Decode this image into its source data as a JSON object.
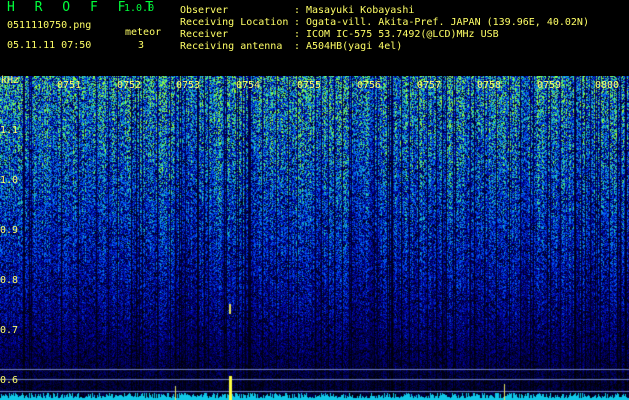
{
  "app": {
    "name": "H R O F F T",
    "version": "1.0.0"
  },
  "file": {
    "name": "0511110750.png",
    "datetime": "05.11.11 07:50"
  },
  "meteor": {
    "label": "meteor",
    "count": "3"
  },
  "info": [
    {
      "label": "Observer",
      "sep": ":",
      "value": "Masayuki Kobayashi"
    },
    {
      "label": "Receiving Location",
      "sep": ":",
      "value": "Ogata-vill. Akita-Pref. JAPAN (139.96E, 40.02N)"
    },
    {
      "label": "Receiver",
      "sep": ":",
      "value": "ICOM IC-575 53.7492(@LCD)MHz USB"
    },
    {
      "label": "Receiving antenna",
      "sep": ":",
      "value": "A504HB(yagi 4el)"
    }
  ],
  "axis": {
    "unit": "kHz",
    "freq_ticks": [
      "1.1",
      "1.0",
      "0.9",
      "0.8",
      "0.7",
      "0.6"
    ],
    "time_ticks": [
      "0751",
      "0752",
      "0753",
      "0754",
      "0755",
      "0756",
      "0757",
      "0758",
      "0759",
      "0800"
    ]
  },
  "colors": {
    "text_yellow": "#ffff66",
    "text_green": "#00ff3c",
    "background": "#000000"
  }
}
